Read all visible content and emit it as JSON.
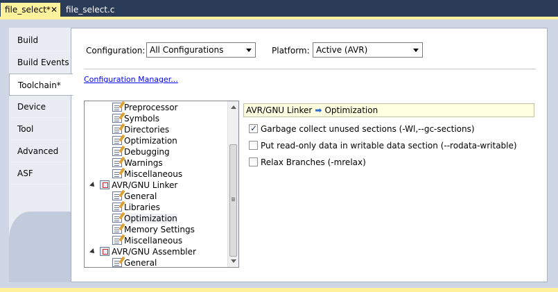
{
  "doc_tabs": [
    {
      "label": "file_select*",
      "close": "✕"
    },
    {
      "label": "file_select.c"
    }
  ],
  "side_tabs": [
    "Build",
    "Build Events",
    "Toolchain*",
    "Device",
    "Tool",
    "Advanced",
    "ASF"
  ],
  "active_side_tab": "Toolchain*",
  "config": {
    "configuration_label": "Configuration:",
    "configuration_value": "All Configurations",
    "platform_label": "Platform:",
    "platform_value": "Active (AVR)",
    "manager_link": "Configuration Manager..."
  },
  "tree": {
    "items": [
      {
        "label": "Preprocessor"
      },
      {
        "label": "Symbols"
      },
      {
        "label": "Directories"
      },
      {
        "label": "Optimization"
      },
      {
        "label": "Debugging"
      },
      {
        "label": "Warnings"
      },
      {
        "label": "Miscellaneous"
      },
      {
        "label": "AVR/GNU Linker"
      },
      {
        "label": "General"
      },
      {
        "label": "Libraries"
      },
      {
        "label": "Optimization"
      },
      {
        "label": "Memory Settings"
      },
      {
        "label": "Miscellaneous"
      },
      {
        "label": "AVR/GNU Assembler"
      },
      {
        "label": "General"
      }
    ]
  },
  "breadcrumb": {
    "parent": "AVR/GNU Linker",
    "arrow": "➡",
    "child": "Optimization"
  },
  "options": [
    {
      "label": "Garbage collect unused sections (-Wl,--gc-sections)",
      "checked": true
    },
    {
      "label": "Put read-only data in writable data section (--rodata-writable)",
      "checked": false
    },
    {
      "label": "Relax Branches (-mrelax)",
      "checked": false
    }
  ],
  "colors": {
    "active_tab": "#fff29d",
    "background": "#2b3c59",
    "frame": "#cfd6e5",
    "link": "#0000ee"
  }
}
